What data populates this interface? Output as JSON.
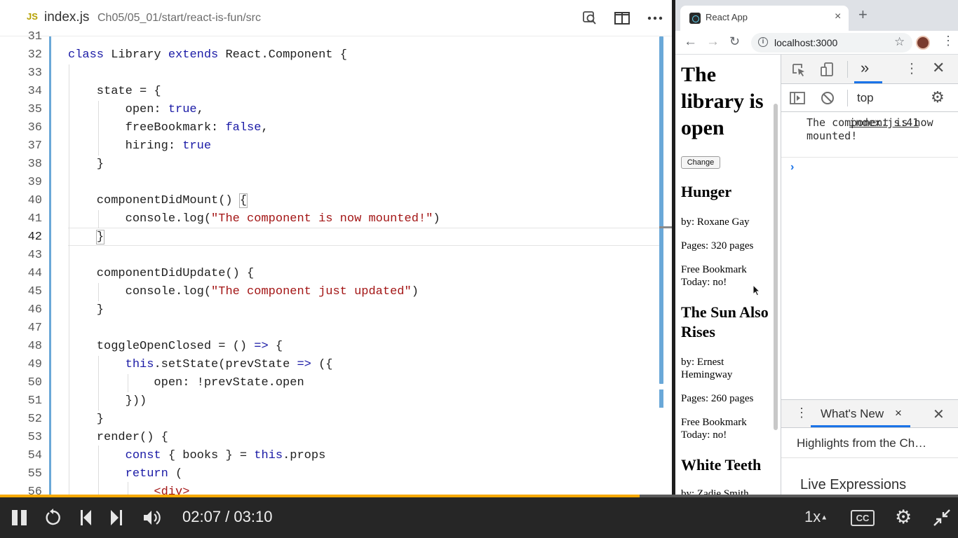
{
  "editor": {
    "language_badge": "JS",
    "file_name": "index.js",
    "file_path": "Ch05/05_01/start/react-is-fun/src",
    "lines": [
      {
        "n": "31",
        "tokens": [
          {
            "t": "",
            "c": ""
          }
        ]
      },
      {
        "n": "32",
        "tokens": [
          {
            "t": "class",
            "c": "kw"
          },
          {
            "t": " Library ",
            "c": ""
          },
          {
            "t": "extends",
            "c": "kw"
          },
          {
            "t": " React.Component {",
            "c": ""
          }
        ]
      },
      {
        "n": "33",
        "tokens": [
          {
            "t": "",
            "c": ""
          }
        ]
      },
      {
        "n": "34",
        "tokens": [
          {
            "t": "    state = {",
            "c": ""
          }
        ]
      },
      {
        "n": "35",
        "tokens": [
          {
            "t": "        open: ",
            "c": ""
          },
          {
            "t": "true",
            "c": "kw"
          },
          {
            "t": ",",
            "c": ""
          }
        ]
      },
      {
        "n": "36",
        "tokens": [
          {
            "t": "        freeBookmark: ",
            "c": ""
          },
          {
            "t": "false",
            "c": "kw"
          },
          {
            "t": ",",
            "c": ""
          }
        ]
      },
      {
        "n": "37",
        "tokens": [
          {
            "t": "        hiring: ",
            "c": ""
          },
          {
            "t": "true",
            "c": "kw"
          }
        ]
      },
      {
        "n": "38",
        "tokens": [
          {
            "t": "    }",
            "c": ""
          }
        ]
      },
      {
        "n": "39",
        "tokens": [
          {
            "t": "",
            "c": ""
          }
        ]
      },
      {
        "n": "40",
        "tokens": [
          {
            "t": "    componentDidMount() ",
            "c": ""
          },
          {
            "t": "{",
            "c": "box"
          }
        ]
      },
      {
        "n": "41",
        "tokens": [
          {
            "t": "        console.log(",
            "c": ""
          },
          {
            "t": "\"The component is now mounted!\"",
            "c": "str"
          },
          {
            "t": ")",
            "c": ""
          }
        ]
      },
      {
        "n": "42",
        "tokens": [
          {
            "t": "    ",
            "c": ""
          },
          {
            "t": "}",
            "c": "box"
          }
        ],
        "current": true
      },
      {
        "n": "43",
        "tokens": [
          {
            "t": "",
            "c": ""
          }
        ]
      },
      {
        "n": "44",
        "tokens": [
          {
            "t": "    componentDidUpdate() {",
            "c": ""
          }
        ]
      },
      {
        "n": "45",
        "tokens": [
          {
            "t": "        console.log(",
            "c": ""
          },
          {
            "t": "\"The component just updated\"",
            "c": "str"
          },
          {
            "t": ")",
            "c": ""
          }
        ]
      },
      {
        "n": "46",
        "tokens": [
          {
            "t": "    }",
            "c": ""
          }
        ]
      },
      {
        "n": "47",
        "tokens": [
          {
            "t": "",
            "c": ""
          }
        ]
      },
      {
        "n": "48",
        "tokens": [
          {
            "t": "    toggleOpenClosed = () ",
            "c": ""
          },
          {
            "t": "=>",
            "c": "kw"
          },
          {
            "t": " {",
            "c": ""
          }
        ]
      },
      {
        "n": "49",
        "tokens": [
          {
            "t": "        ",
            "c": ""
          },
          {
            "t": "this",
            "c": "kw"
          },
          {
            "t": ".setState(prevState ",
            "c": ""
          },
          {
            "t": "=>",
            "c": "kw"
          },
          {
            "t": " ({",
            "c": ""
          }
        ]
      },
      {
        "n": "50",
        "tokens": [
          {
            "t": "            open: !prevState.open",
            "c": ""
          }
        ]
      },
      {
        "n": "51",
        "tokens": [
          {
            "t": "        }))",
            "c": ""
          }
        ]
      },
      {
        "n": "52",
        "tokens": [
          {
            "t": "    }",
            "c": ""
          }
        ]
      },
      {
        "n": "53",
        "tokens": [
          {
            "t": "    render() {",
            "c": ""
          }
        ]
      },
      {
        "n": "54",
        "tokens": [
          {
            "t": "        ",
            "c": ""
          },
          {
            "t": "const",
            "c": "kw"
          },
          {
            "t": " { books } = ",
            "c": ""
          },
          {
            "t": "this",
            "c": "kw"
          },
          {
            "t": ".props",
            "c": ""
          }
        ]
      },
      {
        "n": "55",
        "tokens": [
          {
            "t": "        ",
            "c": ""
          },
          {
            "t": "return",
            "c": "kw"
          },
          {
            "t": " (",
            "c": ""
          }
        ]
      },
      {
        "n": "56",
        "tokens": [
          {
            "t": "            <div>",
            "c": "str"
          }
        ]
      }
    ],
    "icons": {
      "search": "search-preview-icon",
      "split": "split-editor-icon",
      "more": "more-icon"
    }
  },
  "browser": {
    "tab_title": "React App",
    "tab_close": "×",
    "new_tab": "+",
    "url": "localhost:3000",
    "page": {
      "heading": "The library is open",
      "change_button": "Change",
      "books": [
        {
          "title": "Hunger",
          "author": "by: Roxane Gay",
          "pages": "Pages: 320 pages",
          "bookmark": "Free Bookmark Today: no!"
        },
        {
          "title": "The Sun Also Rises",
          "author": "by: Ernest Hemingway",
          "pages": "Pages: 260 pages",
          "bookmark": "Free Bookmark Today: no!"
        },
        {
          "title": "White Teeth",
          "author": "by: Zadie Smith"
        }
      ]
    },
    "devtools": {
      "context": "top",
      "log_message": "The component is now mounted!",
      "log_source": "index.js:41",
      "prompt": "›",
      "drawer_tab": "What's New",
      "drawer_tab_close": "×",
      "drawer_text": "Highlights from the Ch…",
      "live_expressions": "Live Expressions"
    }
  },
  "player": {
    "time": "02:07 / 03:10",
    "progress": 0.668,
    "speed": "1x",
    "cc": "CC",
    "accent": "#f6a800"
  }
}
